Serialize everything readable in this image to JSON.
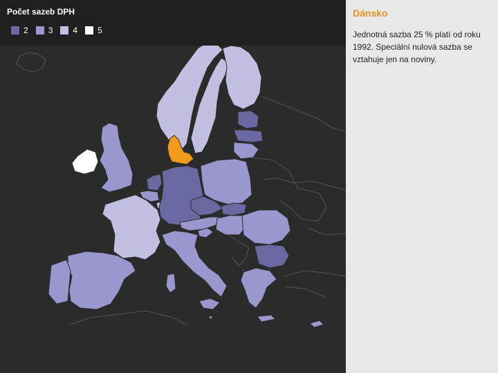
{
  "legend": {
    "title": "Počet sazeb DPH",
    "items": [
      {
        "label": "2",
        "color": "#6a68a0"
      },
      {
        "label": "3",
        "color": "#9a97cf"
      },
      {
        "label": "4",
        "color": "#c2c0e0"
      },
      {
        "label": "5",
        "color": "#ffffff"
      }
    ]
  },
  "selected_color": "#f29a1c",
  "info": {
    "title": "Dánsko",
    "text": "Jednotná sazba 25 % platí od roku 1992. Speciální nulová sazba se vztahuje jen na noviny."
  },
  "regions": [
    {
      "name": "Norsko",
      "category": null
    },
    {
      "name": "Švédsko",
      "category": "4"
    },
    {
      "name": "Finsko",
      "category": "4"
    },
    {
      "name": "Estonsko",
      "category": "2"
    },
    {
      "name": "Lotyšsko",
      "category": "3"
    },
    {
      "name": "Litva",
      "category": "3"
    },
    {
      "name": "Irsko",
      "category": "5"
    },
    {
      "name": "Spojené království",
      "category": "3"
    },
    {
      "name": "Dánsko",
      "category": "selected"
    },
    {
      "name": "Nizozemsko",
      "category": "2"
    },
    {
      "name": "Belgie",
      "category": "3"
    },
    {
      "name": "Lucembursko",
      "category": "4"
    },
    {
      "name": "Německo",
      "category": "2"
    },
    {
      "name": "Polsko",
      "category": "3"
    },
    {
      "name": "Česko",
      "category": "2"
    },
    {
      "name": "Slovensko",
      "category": "2"
    },
    {
      "name": "Rakousko",
      "category": "3"
    },
    {
      "name": "Maďarsko",
      "category": "3"
    },
    {
      "name": "Slovinsko",
      "category": "3"
    },
    {
      "name": "Francie",
      "category": "4"
    },
    {
      "name": "Španělsko",
      "category": "3"
    },
    {
      "name": "Portugalsko",
      "category": "3"
    },
    {
      "name": "Itálie",
      "category": "3"
    },
    {
      "name": "Rumunsko",
      "category": "3"
    },
    {
      "name": "Bulharsko",
      "category": "2"
    },
    {
      "name": "Řecko",
      "category": "3"
    },
    {
      "name": "Kypr",
      "category": "3"
    },
    {
      "name": "Malta",
      "category": "3"
    }
  ]
}
